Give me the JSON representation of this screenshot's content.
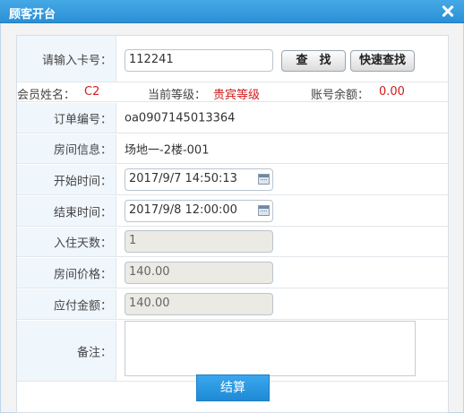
{
  "window": {
    "title": "顾客开台"
  },
  "card": {
    "label": "请输入卡号：",
    "value": "112241",
    "search_label": "查　找",
    "quick_search_label": "快速查找"
  },
  "member": {
    "name_label": "会员姓名：",
    "name_value": "C2",
    "level_label": "当前等级：",
    "level_value": "贵宾等级",
    "balance_label": "账号余额：",
    "balance_value": "0.00"
  },
  "order": {
    "label": "订单编号：",
    "value": "oa0907145013364"
  },
  "room": {
    "label": "房间信息：",
    "value": "场地一-2楼-001"
  },
  "start": {
    "label": "开始时间：",
    "value": "2017/9/7 14:50:13"
  },
  "end": {
    "label": "结束时间：",
    "value": "2017/9/8 12:00:00"
  },
  "days": {
    "label": "入住天数：",
    "value": "1"
  },
  "price": {
    "label": "房间价格：",
    "value": "140.00"
  },
  "payable": {
    "label": "应付金额：",
    "value": "140.00"
  },
  "remark": {
    "label": "备注：",
    "value": ""
  },
  "actions": {
    "submit_label": "结算"
  },
  "colors": {
    "accent": "#2b8fd6",
    "highlight": "#d11d1d",
    "label_bg": "#eff6fc"
  }
}
